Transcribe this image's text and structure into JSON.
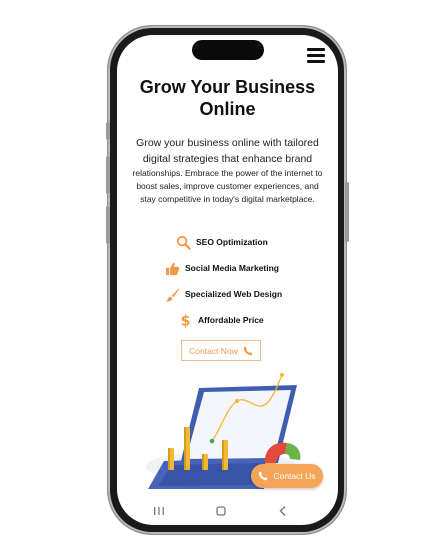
{
  "header": {
    "title": "Grow Your Business Online",
    "menu_icon": "hamburger-menu-icon"
  },
  "intro": {
    "line_large": "Grow your business online with tailored digital strategies that enhance brand",
    "line_small": "relationships. Embrace the power of the internet to boost sales, improve customer experiences, and stay competitive in today's digital marketplace."
  },
  "features": [
    {
      "label": "SEO Optimization",
      "icon": "search-icon"
    },
    {
      "label": "Social Media Marketing",
      "icon": "thumbs-up-icon"
    },
    {
      "label": "Specialized Web Design",
      "icon": "paint-brush-icon"
    },
    {
      "label": "Affordable Price",
      "icon": "dollar-icon"
    }
  ],
  "buttons": {
    "contact_now": "Contact Now",
    "contact_us": "Contact Us"
  },
  "colors": {
    "accent": "#f39a48",
    "accent_light": "#f5a55a",
    "text": "#111111",
    "laptop": "#3f5fae"
  },
  "android_nav": [
    "recent-apps-icon",
    "home-icon",
    "back-icon"
  ]
}
